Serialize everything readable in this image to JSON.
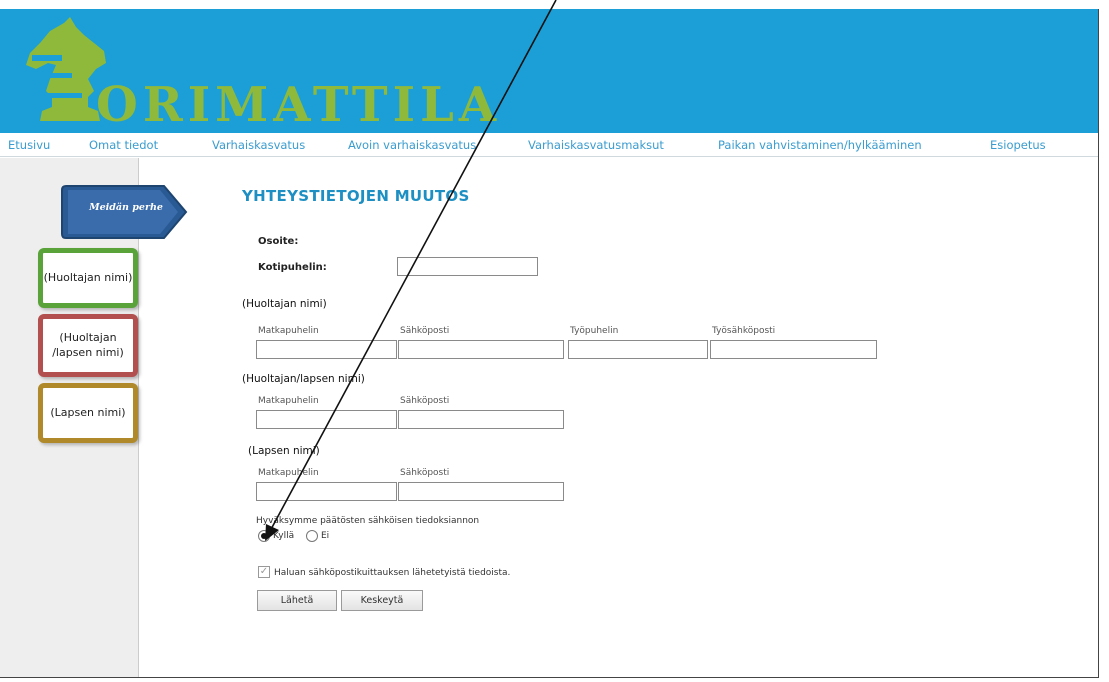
{
  "colors": {
    "header_bg": "#1c9fd6",
    "logo_green": "#8fb93a",
    "nav_text": "#3a9ccf",
    "title": "#1d8fc2"
  },
  "logo": {
    "text": "ORIMATTILA",
    "icon": "chess-knight-icon"
  },
  "nav": [
    "Etusivu",
    "Omat tiedot",
    "Varhaiskasvatus",
    "Avoin varhaiskasvatus",
    "Varhaiskasvatusmaksut",
    "Paikan vahvistaminen/hylkääminen",
    "Esiopetus"
  ],
  "sidebar": {
    "tab_label": "Meidän perhe",
    "cards": [
      "(Huoltajan nimi)",
      "(Huoltajan /lapsen nimi)",
      "(Lapsen nimi)"
    ]
  },
  "form": {
    "title": "YHTEYSTIETOJEN MUUTOS",
    "osoite_label": "Osoite:",
    "kotipuhelin_label": "Kotipuhelin:",
    "sections": [
      {
        "name": "(Huoltajan nimi)",
        "fields": [
          "Matkapuhelin",
          "Sähköposti",
          "Työpuhelin",
          "Työsähköposti"
        ]
      },
      {
        "name": "(Huoltajan/lapsen nimi)",
        "fields": [
          "Matkapuhelin",
          "Sähköposti"
        ]
      },
      {
        "name": "(Lapsen nimi)",
        "fields": [
          "Matkapuhelin",
          "Sähköposti"
        ]
      }
    ],
    "consent_text": "Hyväksymme päätösten sähköisen tiedoksiannon",
    "radio_yes": "Kyllä",
    "radio_no": "Ei",
    "radio_selected": "Kyllä",
    "checkbox_label": "Haluan sähköpostikuittauksen lähetetyistä tiedoista.",
    "checkbox_checked": true,
    "send_button": "Lähetä",
    "cancel_button": "Keskeytä"
  }
}
